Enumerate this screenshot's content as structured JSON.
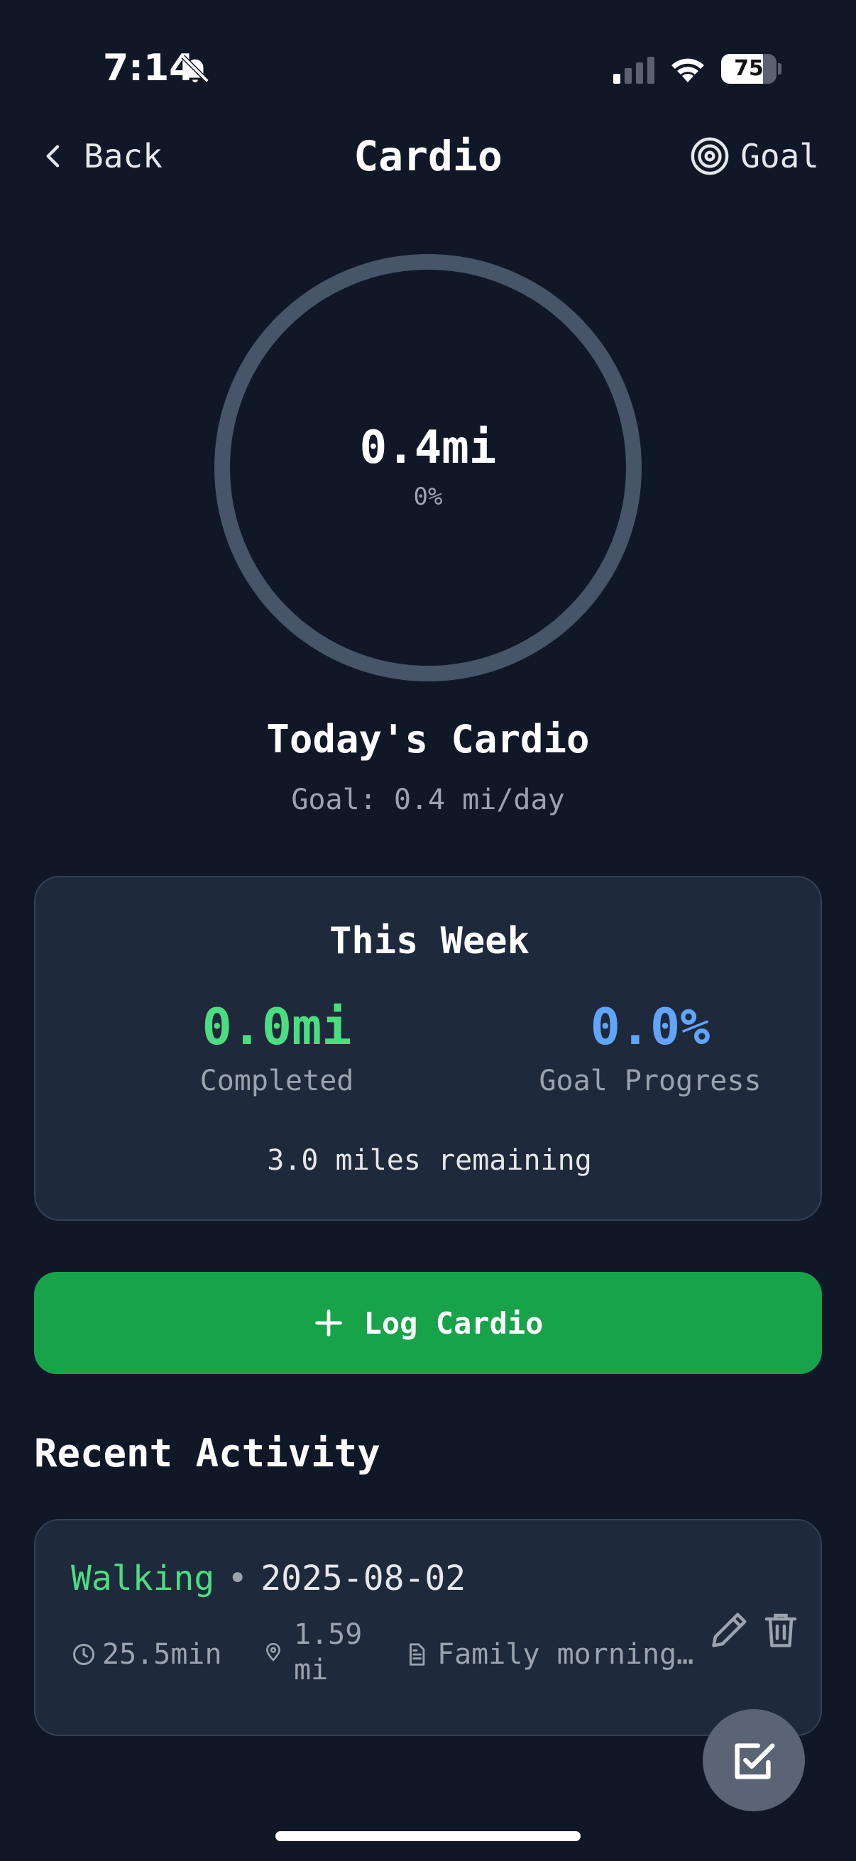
{
  "status_bar": {
    "time": "7:14",
    "battery": "75",
    "battery_level": 0.75,
    "icons": [
      "bell-off-icon",
      "signal-icon",
      "wifi-icon",
      "battery-icon"
    ]
  },
  "header": {
    "back_label": "Back",
    "title": "Cardio",
    "goal_label": "Goal"
  },
  "progress_ring": {
    "value": "0.4mi",
    "percent": "0%",
    "progress_fraction": 0,
    "track_color": "#475569"
  },
  "today": {
    "title": "Today's Cardio",
    "goal": "Goal: 0.4 mi/day"
  },
  "week": {
    "title": "This Week",
    "completed_value": "0.0mi",
    "completed_label": "Completed",
    "progress_value": "0.0%",
    "progress_label": "Goal Progress",
    "remaining": "3.0 miles remaining"
  },
  "log_button": {
    "label": "Log Cardio"
  },
  "recent": {
    "title": "Recent Activity",
    "items": [
      {
        "type": "Walking",
        "separator": "•",
        "date": "2025-08-02",
        "duration": "25.5min",
        "distance": "1.59 mi",
        "notes": "Family morning…"
      }
    ]
  },
  "colors": {
    "background": "#101828",
    "card": "#1e293b",
    "accent_green": "#4ade80",
    "accent_blue": "#60a5fa",
    "button_green": "#16a34a",
    "muted_text": "#9ca3af"
  }
}
